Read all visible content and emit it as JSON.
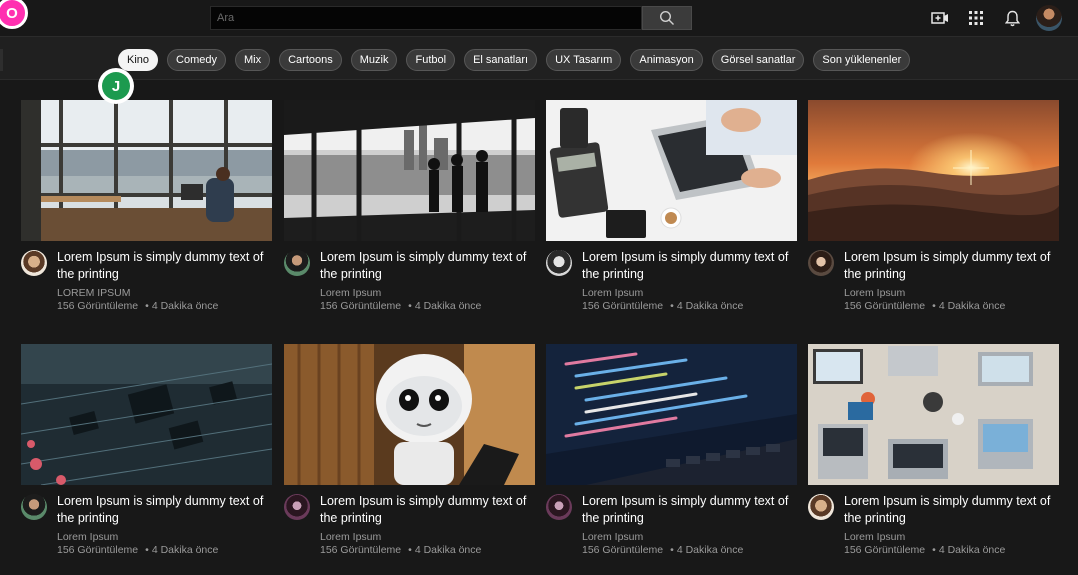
{
  "logo": {
    "letter": "O"
  },
  "search": {
    "placeholder": "Ara"
  },
  "topbar": {
    "icons": [
      "video-add-icon",
      "apps-grid-icon",
      "bell-icon"
    ],
    "avatar": "user-avatar"
  },
  "chips": [
    {
      "label": "Kino",
      "active": true
    },
    {
      "label": "Comedy"
    },
    {
      "label": "Mix"
    },
    {
      "label": "Cartoons"
    },
    {
      "label": "Muzik"
    },
    {
      "label": "Futbol"
    },
    {
      "label": "El sanatları"
    },
    {
      "label": "UX Tasarım"
    },
    {
      "label": "Animasyon"
    },
    {
      "label": "Görsel sanatlar"
    },
    {
      "label": "Son yüklenenler"
    }
  ],
  "badge": {
    "letter": "J",
    "color": "#1c9a4f"
  },
  "videos": [
    {
      "thumb": "office-window-photo",
      "title": "Lorem Ipsum is simply dummy text of the printing",
      "channel": "LOREM IPSUM",
      "views": "156 Görüntüleme",
      "time": "4 Dakika önce"
    },
    {
      "thumb": "city-window-silhouettes-photo",
      "title": "Lorem Ipsum is simply dummy text of the printing",
      "channel": "Lorem Ipsum",
      "views": "156 Görüntüleme",
      "time": "4 Dakika önce"
    },
    {
      "thumb": "laptop-desk-photo",
      "title": "Lorem Ipsum is simply dummy text of the printing",
      "channel": "Lorem Ipsum",
      "views": "156 Görüntüleme",
      "time": "4 Dakika önce"
    },
    {
      "thumb": "sunset-mountains-photo",
      "title": "Lorem Ipsum is simply dummy text of the printing",
      "channel": "Lorem Ipsum",
      "views": "156 Görüntüleme",
      "time": "4 Dakika önce"
    },
    {
      "thumb": "circuit-board-photo",
      "title": "Lorem Ipsum is simply dummy text of the printing",
      "channel": "Lorem Ipsum",
      "views": "156 Görüntüleme",
      "time": "4 Dakika önce"
    },
    {
      "thumb": "robot-photo",
      "title": "Lorem Ipsum is simply dummy text of the printing",
      "channel": "Lorem Ipsum",
      "views": "156 Görüntüleme",
      "time": "4 Dakika önce"
    },
    {
      "thumb": "code-screen-photo",
      "title": "Lorem Ipsum is simply dummy text of the printing",
      "channel": "Lorem Ipsum",
      "views": "156 Görüntüleme",
      "time": "4 Dakika önce"
    },
    {
      "thumb": "team-desk-laptops-photo",
      "title": "Lorem Ipsum is simply dummy text of the printing",
      "channel": "Lorem Ipsum",
      "views": "156 Görüntüleme",
      "time": "4 Dakika önce"
    }
  ]
}
